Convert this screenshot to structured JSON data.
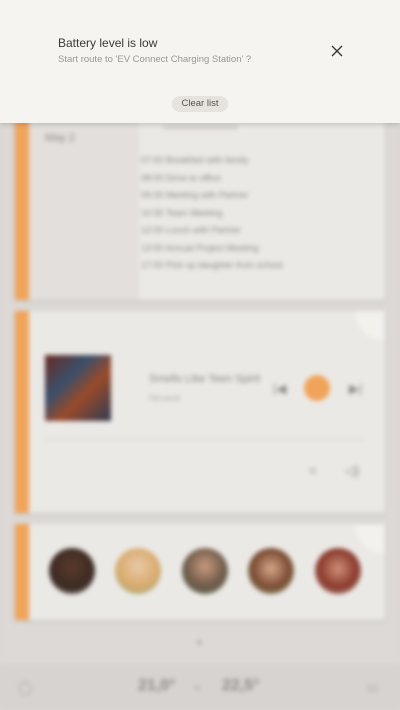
{
  "notification": {
    "title": "Battery level is low",
    "subtitle": "Start route to 'EV Connect Charging Station' ?",
    "clear_label": "Clear list",
    "close_icon": "close-icon"
  },
  "agenda": {
    "date": "May 2",
    "items": [
      "07:00 Breakfast with family",
      "08:00 Drive to office",
      "09:30 Meeting with Partner",
      "10:30 Team Meeting",
      "12:00 Lunch with Partner",
      "13:00 Annual Project Meeting",
      "17:00 Pick up daughter from school"
    ]
  },
  "music": {
    "title": "Smells Like Teen Spirit",
    "artist": "Nirvana",
    "prev_icon": "skip-previous-icon",
    "play_icon": "play-icon",
    "next_icon": "skip-next-icon",
    "share_icon": "share-icon",
    "volume_icon": "volume-icon"
  },
  "climate": {
    "left_temp": "21,0°",
    "right_temp": "22,5°"
  },
  "colors": {
    "accent": "#f0a45a",
    "notification_bg": "#f6f4f1",
    "clear_button_bg": "#e6e3df"
  }
}
